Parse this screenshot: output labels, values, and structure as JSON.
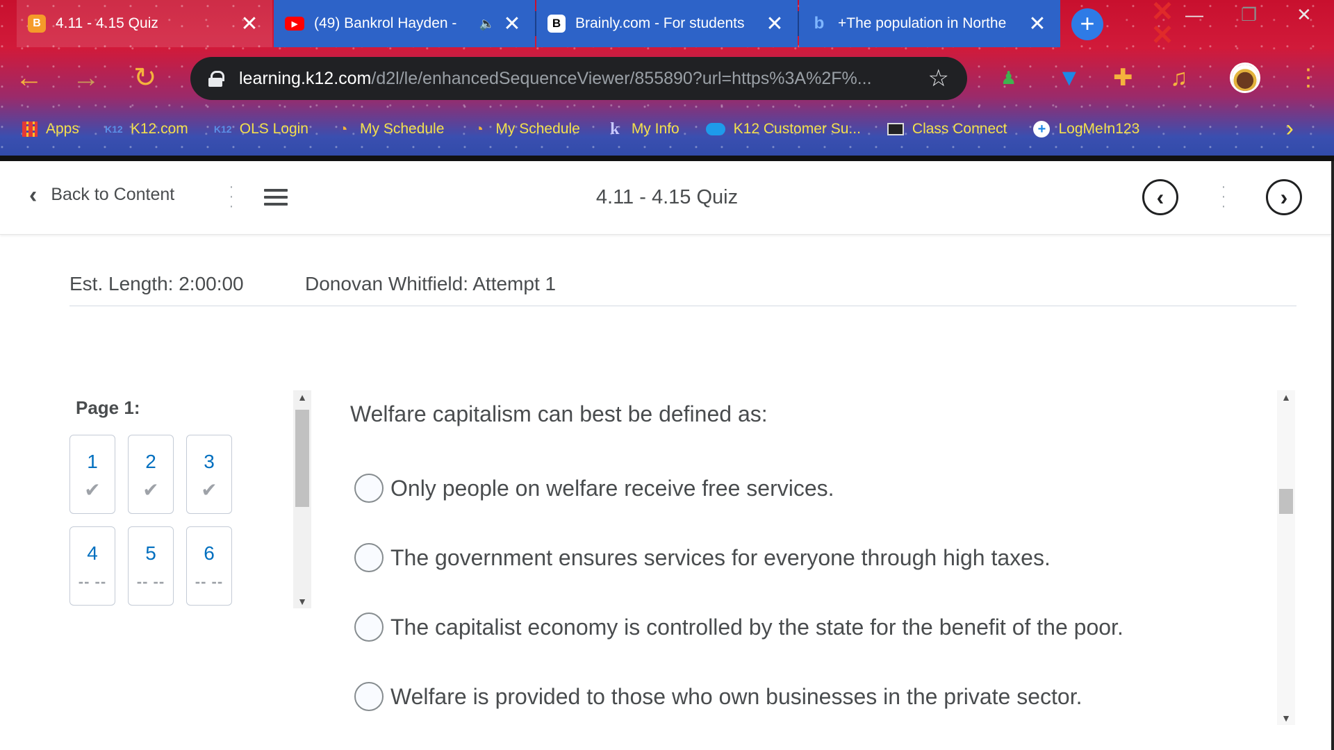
{
  "browser": {
    "tabs": [
      {
        "title": "4.11 - 4.15 Quiz",
        "favicon": "brightspace-icon",
        "active": true
      },
      {
        "title": "(49) Bankrol Hayden -",
        "favicon": "youtube-icon",
        "active": false
      },
      {
        "title": "Brainly.com - For students",
        "favicon": "brainly-icon",
        "active": false
      },
      {
        "title": "+The population in Northe",
        "favicon": "bing-icon",
        "active": false
      }
    ],
    "url_host": "learning.k12.com",
    "url_path": "/d2l/le/enhancedSequenceViewer/855890?url=https%3A%2F%...",
    "bookmarks": [
      {
        "label": "Apps",
        "icon": "apps-grid-icon"
      },
      {
        "label": "K12.com",
        "icon": "k12-icon"
      },
      {
        "label": "OLS Login",
        "icon": "k12-icon"
      },
      {
        "label": "My Schedule",
        "icon": "schedule-icon"
      },
      {
        "label": "My Schedule",
        "icon": "schedule-icon"
      },
      {
        "label": "My Info",
        "icon": "k-info-icon"
      },
      {
        "label": "K12 Customer Su...",
        "icon": "cloud-icon"
      },
      {
        "label": "Class Connect",
        "icon": "video-icon"
      },
      {
        "label": "LogMeIn123",
        "icon": "plus-circle-icon"
      }
    ]
  },
  "header": {
    "back_label": "Back to Content",
    "title": "4.11 - 4.15 Quiz"
  },
  "quiz": {
    "est_length": "Est. Length: 2:00:00",
    "attempt": "Donovan Whitfield: Attempt 1",
    "page_label": "Page 1:",
    "questions": [
      {
        "num": "1",
        "status": "✔"
      },
      {
        "num": "2",
        "status": "✔"
      },
      {
        "num": "3",
        "status": "✔"
      },
      {
        "num": "4",
        "status": "-- --"
      },
      {
        "num": "5",
        "status": "-- --"
      },
      {
        "num": "6",
        "status": "-- --"
      }
    ],
    "question_text": "Welfare capitalism can best be defined as:",
    "options": [
      "Only people on welfare receive free services.",
      "The government ensures services for everyone through high taxes.",
      "The capitalist economy is controlled by the state for the benefit of the poor.",
      "Welfare is provided to those who own businesses in the private sector."
    ]
  },
  "colors": {
    "link_blue": "#006fbf",
    "bookmark_yellow": "#f4e04d",
    "text_gray": "#494c4e"
  }
}
